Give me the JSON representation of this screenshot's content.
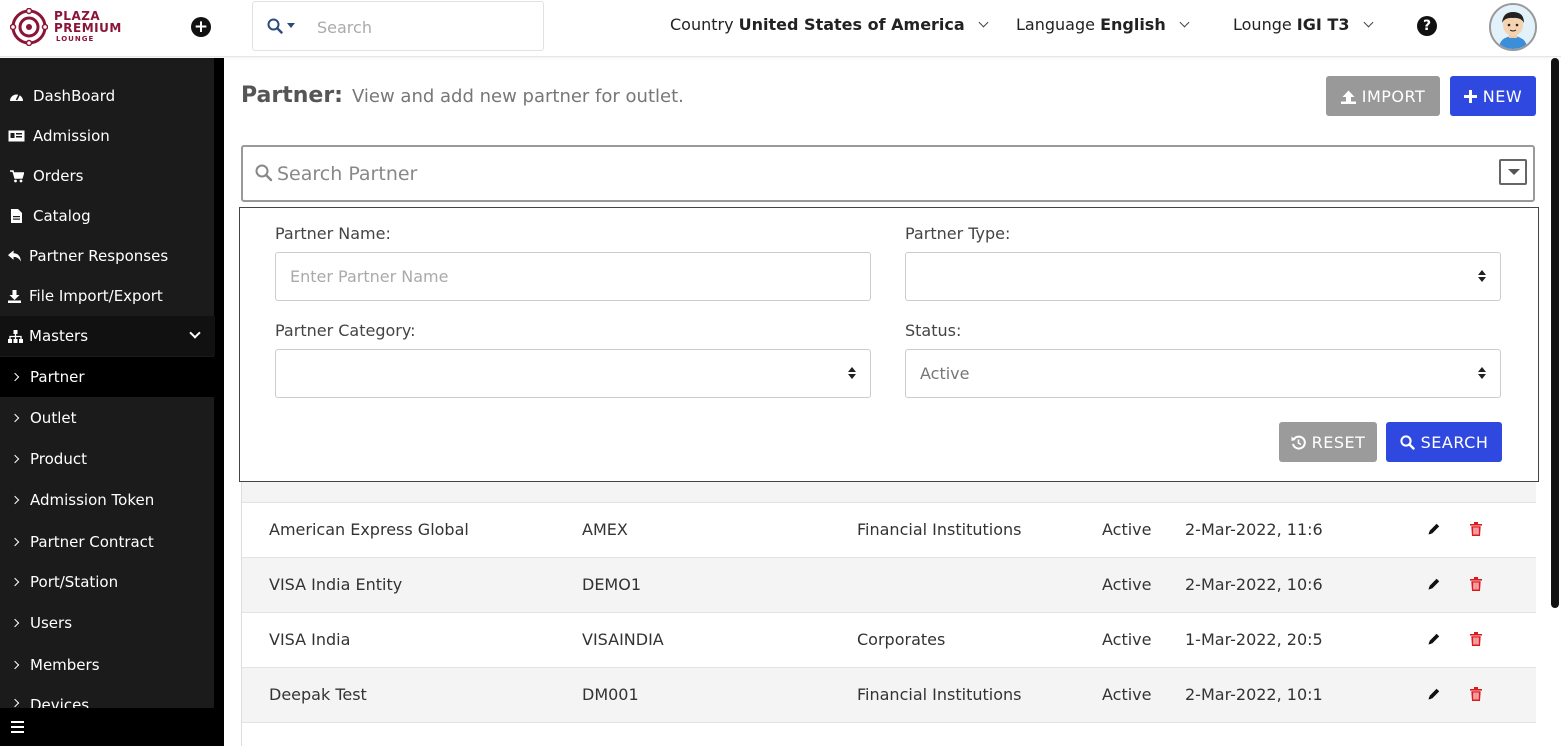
{
  "header": {
    "logo": {
      "line1": "PLAZA",
      "line2": "PREMIUM",
      "line3": "LOUNGE",
      "color": "#8a1538"
    },
    "search_placeholder": "Search",
    "country": {
      "label": "Country",
      "value": "United States of America"
    },
    "language": {
      "label": "Language",
      "value": "English"
    },
    "lounge": {
      "label": "Lounge",
      "value": "IGI T3"
    },
    "help_glyph": "?",
    "add_glyph": "+"
  },
  "sidebar": {
    "items": [
      {
        "label": "DashBoard",
        "icon": "dashboard-icon"
      },
      {
        "label": "Admission",
        "icon": "id-card-icon"
      },
      {
        "label": "Orders",
        "icon": "cart-icon"
      },
      {
        "label": "Catalog",
        "icon": "file-icon"
      },
      {
        "label": "Partner Responses",
        "icon": "reply-icon"
      },
      {
        "label": "File Import/Export",
        "icon": "download-icon"
      },
      {
        "label": "Masters",
        "icon": "sitemap-icon"
      }
    ],
    "sub_items": [
      {
        "label": "Partner"
      },
      {
        "label": "Outlet"
      },
      {
        "label": "Product"
      },
      {
        "label": "Admission Token"
      },
      {
        "label": "Partner Contract"
      },
      {
        "label": "Port/Station"
      },
      {
        "label": "Users"
      },
      {
        "label": "Members"
      },
      {
        "label": "Devices"
      }
    ]
  },
  "page": {
    "title": "Partner:",
    "subtitle": "View and add new partner for outlet.",
    "import_label": "IMPORT",
    "new_label": "NEW",
    "search_placeholder": "Search Partner"
  },
  "filters": {
    "partner_name_label": "Partner Name:",
    "partner_name_placeholder": "Enter Partner Name",
    "partner_type_label": "Partner Type:",
    "partner_type_value": "",
    "partner_category_label": "Partner Category:",
    "partner_category_value": "",
    "status_label": "Status:",
    "status_value": "Active",
    "reset_label": "RESET",
    "search_label": "SEARCH"
  },
  "table": {
    "rows": [
      {
        "name": "American Express Global",
        "code": "AMEX",
        "category": "Financial Institutions",
        "status": "Active",
        "date": "2-Mar-2022, 11:6"
      },
      {
        "name": "VISA India Entity",
        "code": "DEMO1",
        "category": "",
        "status": "Active",
        "date": "2-Mar-2022, 10:6"
      },
      {
        "name": "VISA India",
        "code": "VISAINDIA",
        "category": "Corporates",
        "status": "Active",
        "date": "1-Mar-2022, 20:5"
      },
      {
        "name": "Deepak Test",
        "code": "DM001",
        "category": "Financial Institutions",
        "status": "Active",
        "date": "2-Mar-2022, 10:1"
      }
    ]
  },
  "colors": {
    "primary": "#2e48e0",
    "secondary": "#999999",
    "sidebar": "#1b1b1b",
    "delete": "#e0191e"
  }
}
